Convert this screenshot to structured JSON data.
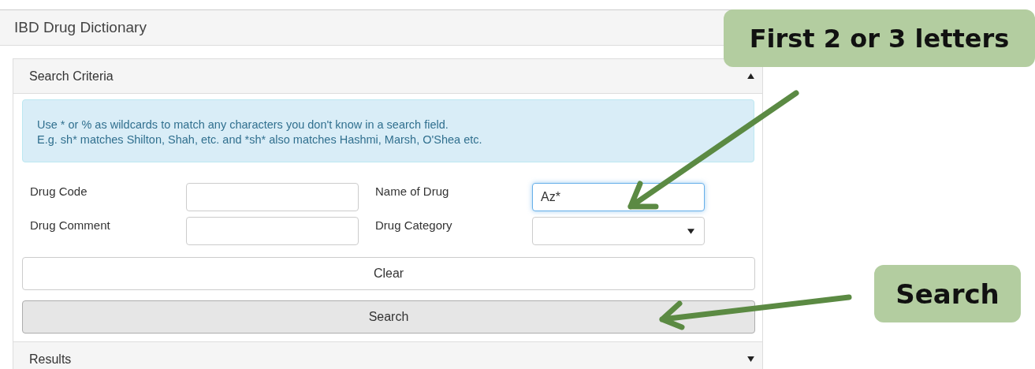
{
  "window": {
    "title": "IBD Drug Dictionary"
  },
  "search_criteria": {
    "title": "Search Criteria",
    "expanded": true,
    "info": [
      "Use * or % as wildcards to match any characters you don't know in a search field.",
      "E.g. sh* matches Shilton, Shah, etc. and *sh* also matches Hashmi, Marsh, O'Shea etc."
    ],
    "fields": [
      {
        "label": "Drug Code",
        "kind": "input",
        "focused": false
      },
      {
        "label": "Name of Drug",
        "kind": "input",
        "value": "Az*",
        "focused": true
      },
      {
        "label": "Drug Comment",
        "kind": "input",
        "focused": false
      },
      {
        "label": "Drug Category",
        "kind": "select",
        "focused": false
      }
    ],
    "buttons": [
      {
        "label": "Clear",
        "kind": "default"
      },
      {
        "label": "Search",
        "kind": "primary"
      }
    ]
  },
  "results": {
    "title": "Results",
    "expanded": false
  },
  "callouts": [
    {
      "text": "First 2 or 3 letters"
    },
    {
      "text": "Search"
    }
  ]
}
